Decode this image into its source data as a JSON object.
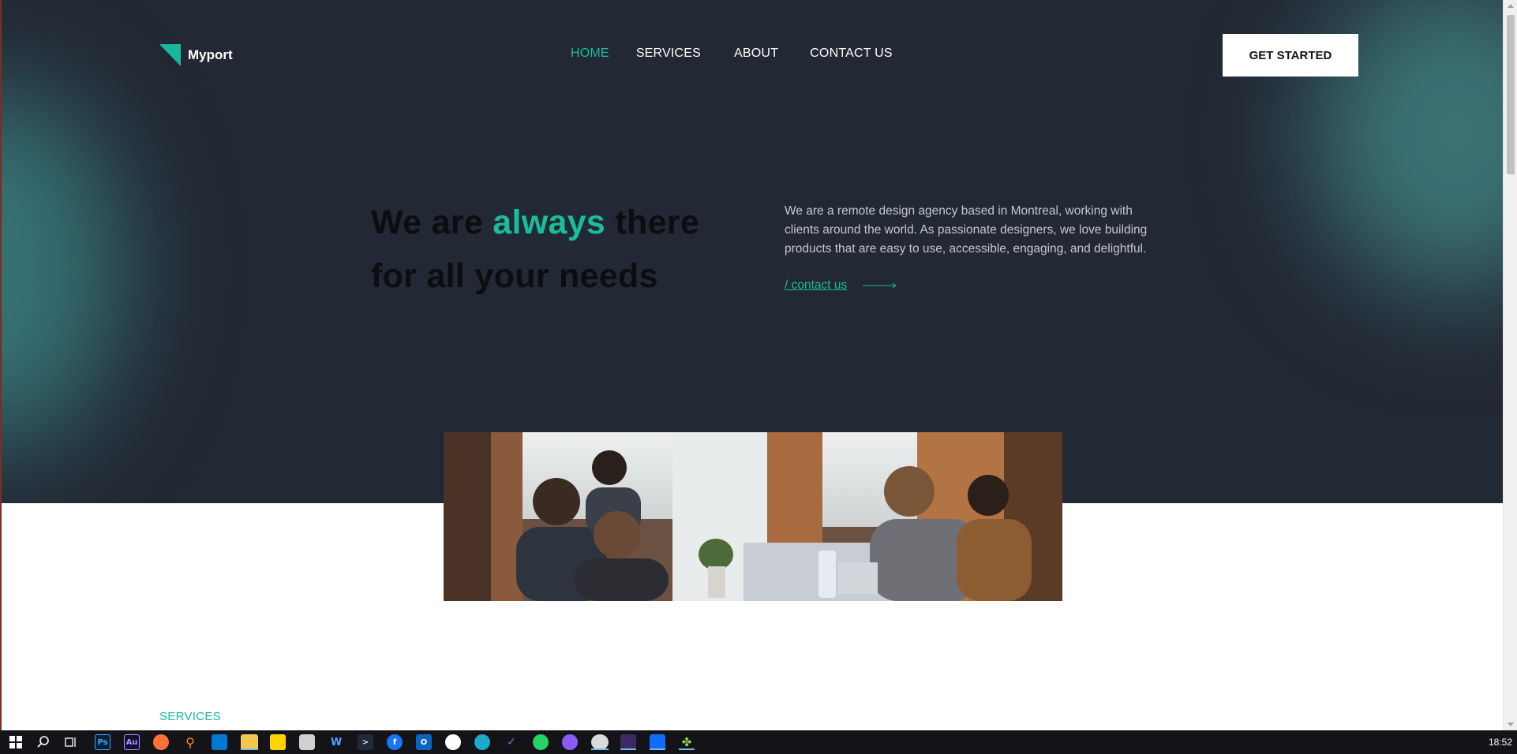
{
  "brand": {
    "name": "Myport",
    "accent_color": "#1bbc9b",
    "dark_bg": "#222834"
  },
  "nav": {
    "items": [
      {
        "label": "HOME",
        "active": true
      },
      {
        "label": "SERVICES",
        "active": false
      },
      {
        "label": "ABOUT",
        "active": false
      },
      {
        "label": "CONTACT US",
        "active": false
      }
    ],
    "cta_label": "GET STARTED"
  },
  "hero": {
    "headline_prefix": "We are",
    "headline_accent": "always",
    "headline_line1_suffix": "there",
    "headline_line2": "for all your needs",
    "intro": "We are a remote design agency based in Montreal, working with clients around the world. As passionate designers, we love building products that are easy to use, accessible, engaging, and delightful.",
    "contact_link": "/ contact us",
    "image": "team-meeting-photo"
  },
  "sections": {
    "services_label": "SERVICES"
  },
  "taskbar": {
    "apps": [
      "start-icon",
      "search-icon",
      "task-view-icon",
      "photoshop-icon",
      "audition-icon",
      "firefox-icon",
      "everything-search-icon",
      "store-icon",
      "file-explorer-icon",
      "sticky-notes-icon",
      "clock-app-icon",
      "wacom-icon",
      "terminal-icon",
      "facebook-icon",
      "outlook-icon",
      "slack-icon",
      "edge-icon",
      "todo-icon",
      "whatsapp-icon",
      "messenger-icon",
      "chrome-icon",
      "media-player-icon",
      "vscode-icon",
      "clover-icon"
    ],
    "clock": "18:52"
  }
}
